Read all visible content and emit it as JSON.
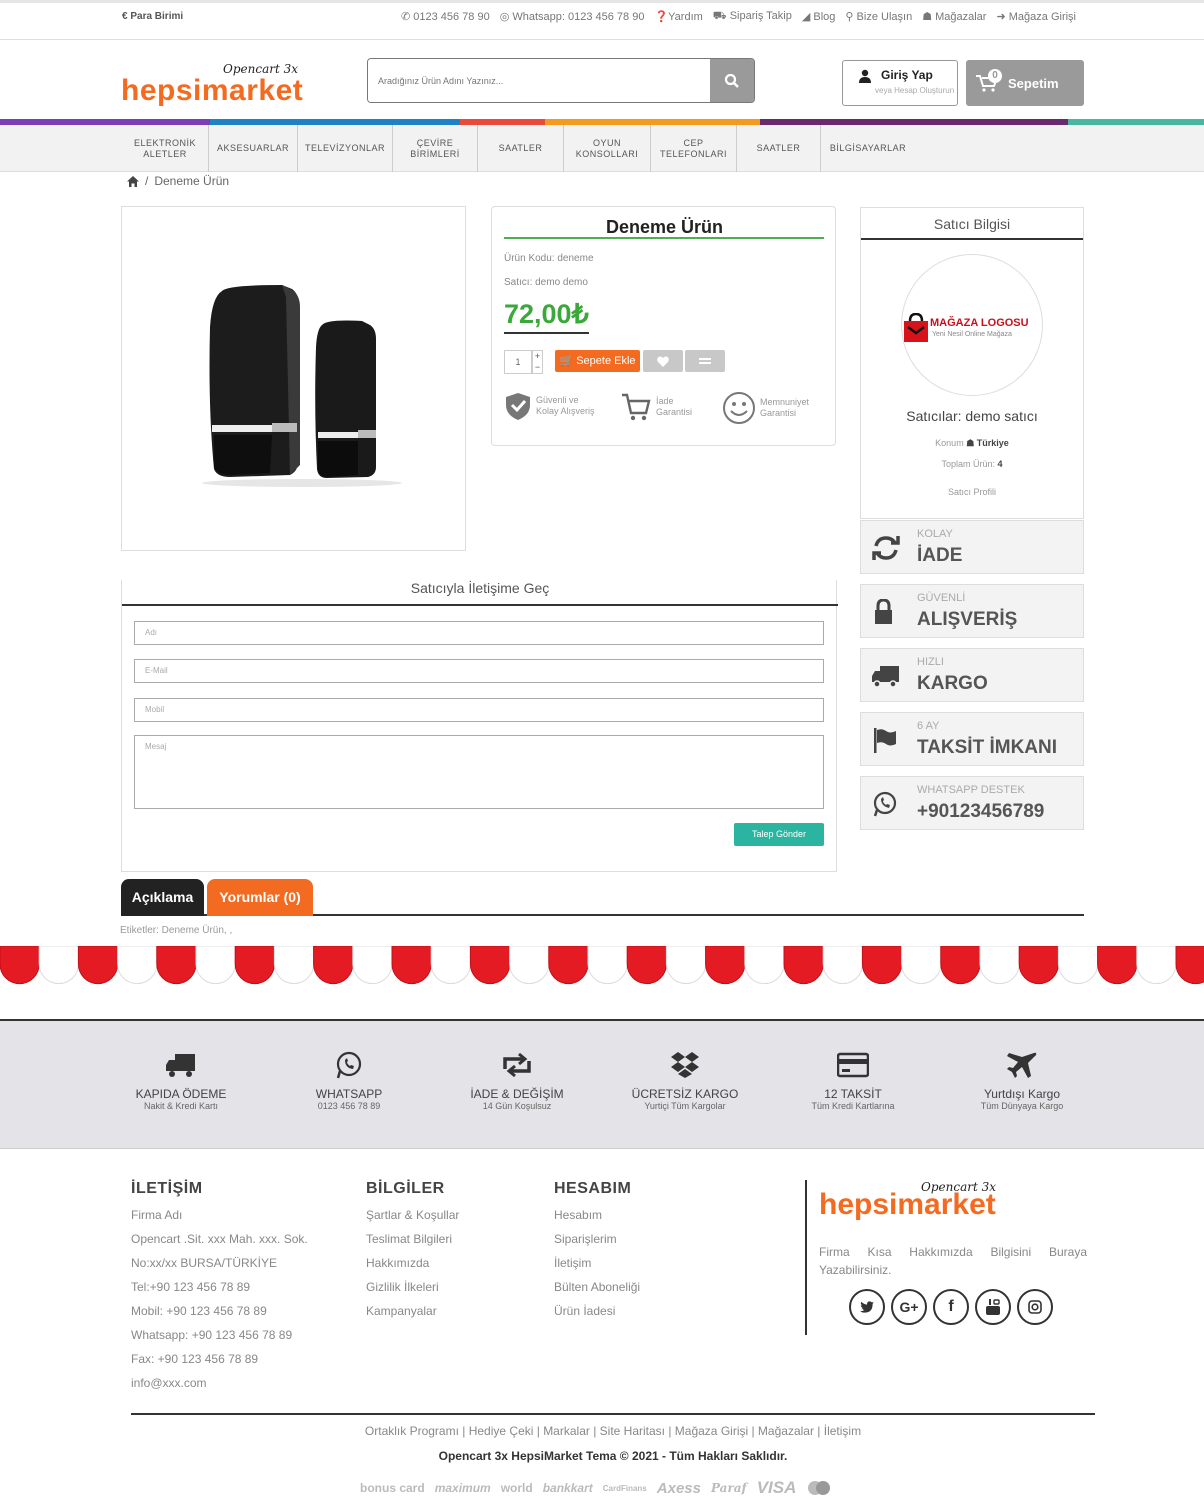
{
  "topbar": {
    "currency": "Para Birimi",
    "phone": "0123 456 78 90",
    "whatsapp": "Whatsapp: 0123 456 78 90",
    "help": "Yardım",
    "order_track": "Sipariş Takip",
    "blog": "Blog",
    "contact": "Bize Ulaşın",
    "stores": "Mağazalar",
    "store_login": "Mağaza Girişi"
  },
  "header": {
    "logo_small": "Opencart 3x",
    "logo_big": "hepsimarket",
    "search_placeholder": "Aradığınız Ürün Adını Yazınız...",
    "login_label": "Giriş Yap",
    "login_sub": "veya Hesap Oluşturun",
    "cart_label": "Sepetim",
    "cart_count": "0"
  },
  "colors": {
    "stripe": [
      "#7b3fb5",
      "#1f82c6",
      "#e84a3b",
      "#f49a1e",
      "#6a2b6e",
      "#49b7a0"
    ],
    "accent": "#f36b21",
    "price": "#3aa83a"
  },
  "nav": [
    {
      "label": "ELEKTRONİK ALETLER"
    },
    {
      "label": "AKSESUARLAR"
    },
    {
      "label": "TELEVİZYONLAR"
    },
    {
      "label": "ÇEVİRE BİRİMLERİ"
    },
    {
      "label": "SAATLER"
    },
    {
      "label": "OYUN KONSOLLARI"
    },
    {
      "label": "CEP TELEFONLARI"
    },
    {
      "label": "SAATLER"
    },
    {
      "label": "BİLGİSAYARLAR"
    }
  ],
  "breadcrumb": {
    "current": "Deneme Ürün"
  },
  "product": {
    "title": "Deneme Ürün",
    "code": "Ürün Kodu: deneme",
    "seller": "Satıcı: demo demo",
    "price": "72,00₺",
    "qty": "1",
    "add_to_cart": "Sepete Ekle",
    "badges": [
      {
        "icon": "shield-icon",
        "line1": "Güvenli ve",
        "line2": "Kolay Alışveriş"
      },
      {
        "icon": "cart-return-icon",
        "line1": "İade",
        "line2": "Garantisi"
      },
      {
        "icon": "smile-icon",
        "line1": "Memnuniyet",
        "line2": "Garantisi"
      }
    ]
  },
  "seller_box": {
    "header": "Satıcı Bilgisi",
    "logo_text": "MAĞAZA LOGOSU",
    "logo_sub": "Yeni Nesil Online Mağaza",
    "name": "Satıcılar: demo satıcı",
    "location_label": "Konum",
    "location_value": "Türkiye",
    "total_label": "Toplam Ürün:",
    "total_value": "4",
    "profile": "Satıcı Profili"
  },
  "features": [
    {
      "icon": "refresh-icon",
      "top": "KOLAY",
      "bottom": "İADE"
    },
    {
      "icon": "lock-icon",
      "top": "GÜVENLİ",
      "bottom": "ALIŞVERİŞ"
    },
    {
      "icon": "truck-icon",
      "top": "HIZLI",
      "bottom": "KARGO"
    },
    {
      "icon": "flag-icon",
      "top": "6 AY",
      "bottom": "TAKSİT İMKANI"
    },
    {
      "icon": "whatsapp-icon",
      "top": "WHATSAPP DESTEK",
      "bottom": "+90123456789"
    }
  ],
  "contact_form": {
    "header": "Satıcıyla İletişime Geç",
    "name_placeholder": "Adı",
    "email_placeholder": "E-Mail",
    "mobile_placeholder": "Mobil",
    "message_placeholder": "Mesaj",
    "send": "Talep Gönder"
  },
  "tabs": {
    "description": "Açıklama",
    "reviews": "Yorumlar (0)"
  },
  "tags": "Etiketler: Deneme Ürün, ,",
  "services": [
    {
      "icon": "truck-icon",
      "title": "KAPIDA ÖDEME",
      "sub": "Nakit & Kredi Kartı"
    },
    {
      "icon": "whatsapp-icon",
      "title": "WHATSAPP",
      "sub": "0123 456 78 89"
    },
    {
      "icon": "retweet-icon",
      "title": "İADE & DEĞİŞİM",
      "sub": "14 Gün Koşulsuz"
    },
    {
      "icon": "dropbox-icon",
      "title": "ÜCRETSİZ KARGO",
      "sub": "Yurtiçi Tüm Kargolar"
    },
    {
      "icon": "credit-card-icon",
      "title": "12 TAKSİT",
      "sub": "Tüm Kredi Kartlarına"
    },
    {
      "icon": "plane-icon",
      "title": "Yurtdışı Kargo",
      "sub": "Tüm Dünyaya Kargo"
    }
  ],
  "footer": {
    "contact_title": "İLETİŞİM",
    "contact_items": [
      "Firma Adı",
      "Opencart .Sit. xxx Mah. xxx. Sok.",
      "No:xx/xx BURSA/TÜRKİYE",
      "Tel:+90 123 456 78 89",
      "Mobil: +90 123 456 78 89",
      "Whatsapp: +90 123 456 78 89",
      "Fax: +90 123 456 78 89",
      "info@xxx.com"
    ],
    "info_title": "BİLGİLER",
    "info_items": [
      "Şartlar & Koşullar",
      "Teslimat Bilgileri",
      "Hakkımızda",
      "Gizlilik İlkeleri",
      "Kampanyalar"
    ],
    "account_title": "HESABIM",
    "account_items": [
      "Hesabım",
      "Siparişlerim",
      "İletişim",
      "Bülten Aboneliği",
      "Ürün İadesi"
    ],
    "logo_small": "Opencart 3x",
    "logo_big": "hepsimarket",
    "desc_line1": "Firma Kısa Hakkımızda Bilgisini Buraya",
    "desc_line2": "Yazabilirsiniz.",
    "links": "Ortaklık Programı | Hediye Çeki | Markalar | Site Haritası | Mağaza Girişi | Mağazalar | İletişim",
    "copyright": "Opencart 3x HepsiMarket Tema © 2021 - Tüm Hakları Saklıdır.",
    "payments": [
      "bonus card",
      "maximum",
      "world",
      "bankkart",
      "CardFinans",
      "Axess",
      "Paraf",
      "VISA"
    ]
  }
}
